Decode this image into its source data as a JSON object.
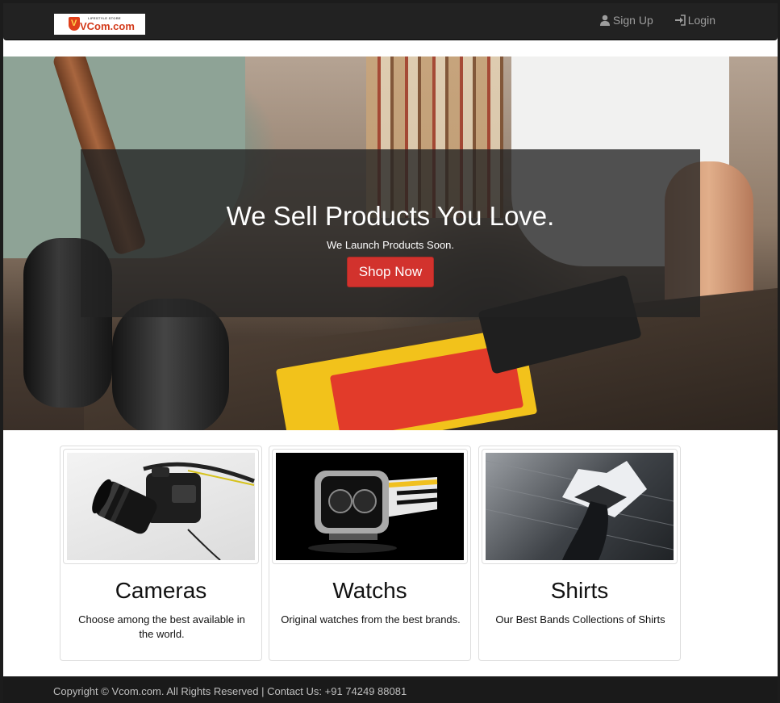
{
  "navbar": {
    "brand": {
      "tagline": "LIFESTYLE STORE",
      "name": "VCom.com"
    },
    "links": [
      {
        "label": "Sign Up",
        "icon": "user-icon"
      },
      {
        "label": "Login",
        "icon": "login-icon"
      }
    ]
  },
  "hero": {
    "title": "We Sell Products You Love.",
    "subtitle": "We Launch Products Soon.",
    "button_label": "Shop Now"
  },
  "cards": [
    {
      "title": "Cameras",
      "description": "Choose among the best available in the world."
    },
    {
      "title": "Watchs",
      "description": "Original watches from the best brands."
    },
    {
      "title": "Shirts",
      "description": "Our Best Bands Collections of Shirts"
    }
  ],
  "footer": {
    "text": "Copyright © Vcom.com. All Rights Reserved | Contact Us: +91 74249 88081"
  },
  "colors": {
    "navbar_bg": "#222222",
    "accent_button": "#d2322d",
    "footer_bg": "#1a1a1a"
  }
}
